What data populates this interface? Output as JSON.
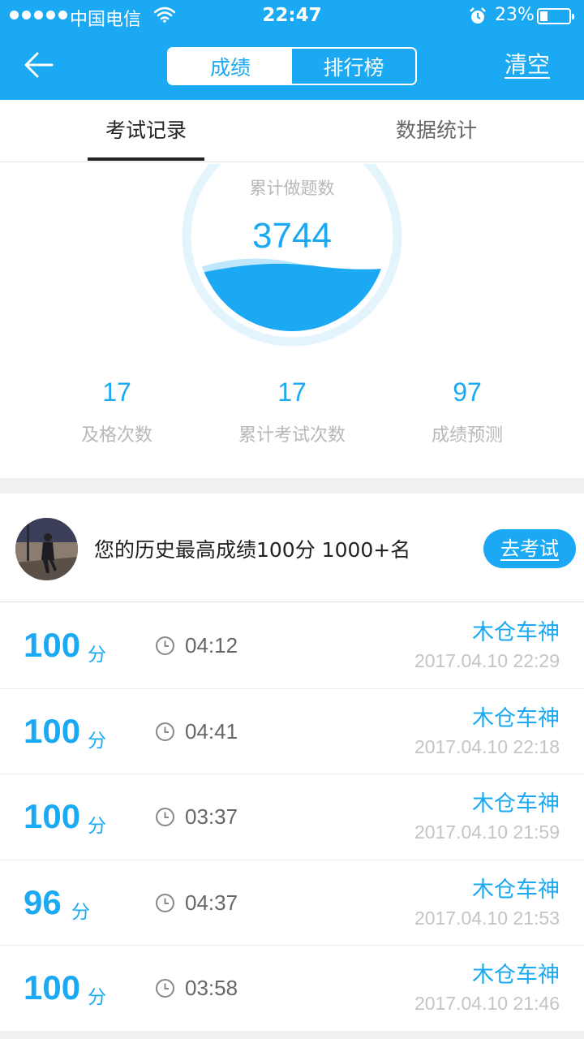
{
  "status_bar": {
    "carrier": "中国电信",
    "time": "22:47",
    "battery": "23%",
    "icons": [
      "signal-icon",
      "wifi-icon",
      "alarm-icon",
      "battery-icon"
    ]
  },
  "nav": {
    "back_icon": "back-arrow-icon",
    "segments": [
      "成绩",
      "排行榜"
    ],
    "active_segment": 0,
    "clear_label": "清空"
  },
  "tabs": {
    "items": [
      "考试记录",
      "数据统计"
    ],
    "active": 0
  },
  "summary": {
    "gauge_label": "累计做题数",
    "gauge_value": "3744",
    "stats": [
      {
        "value": "17",
        "label": "及格次数"
      },
      {
        "value": "17",
        "label": "累计考试次数"
      },
      {
        "value": "97",
        "label": "成绩预测"
      }
    ]
  },
  "best": {
    "text": "您的历史最高成绩100分  1000+名",
    "button_label": "去考试"
  },
  "records": [
    {
      "score": "100",
      "unit": "分",
      "duration": "04:12",
      "name": "木仓车神",
      "date": "2017.04.10 22:29"
    },
    {
      "score": "100",
      "unit": "分",
      "duration": "04:41",
      "name": "木仓车神",
      "date": "2017.04.10 22:18"
    },
    {
      "score": "100",
      "unit": "分",
      "duration": "03:37",
      "name": "木仓车神",
      "date": "2017.04.10 21:59"
    },
    {
      "score": "96",
      "unit": "分",
      "duration": "04:37",
      "name": "木仓车神",
      "date": "2017.04.10 21:53"
    },
    {
      "score": "100",
      "unit": "分",
      "duration": "03:58",
      "name": "木仓车神",
      "date": "2017.04.10 21:46"
    }
  ],
  "colors": {
    "accent": "#1aa9f2",
    "muted": "#b8b8b8"
  }
}
